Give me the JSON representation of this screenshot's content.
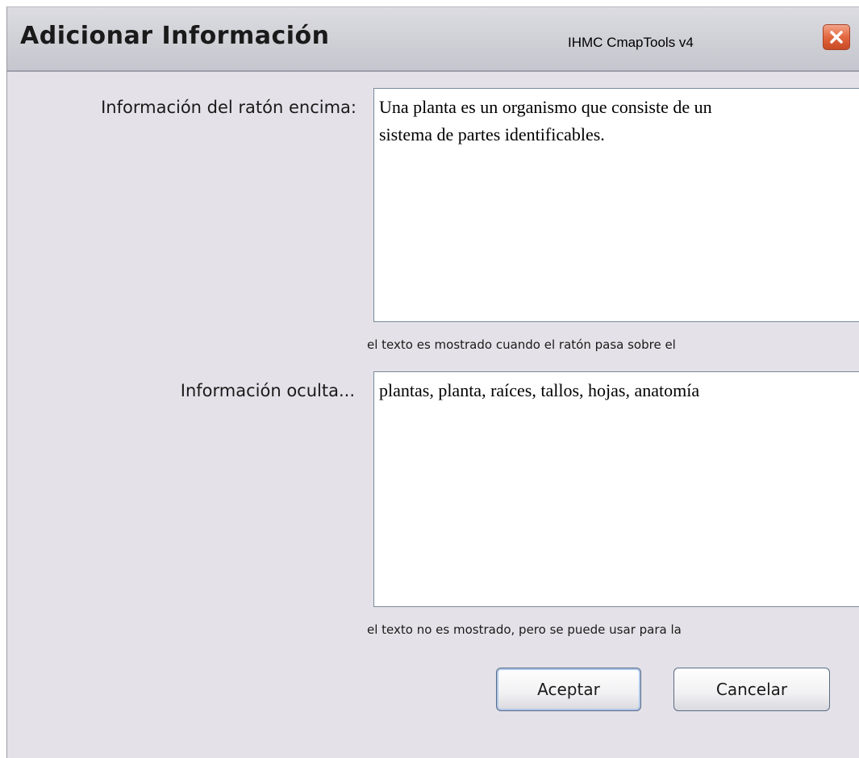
{
  "window": {
    "title": "Adicionar Información",
    "app_name": "IHMC CmapTools v4"
  },
  "form": {
    "mouseover": {
      "label": "Información del ratón encima:",
      "value": "Una planta es un organismo que consiste de un\nsistema de partes identificables.",
      "hint": "el texto es mostrado cuando el ratón pasa sobre el"
    },
    "hidden": {
      "label": "Información oculta...",
      "value": "plantas, planta, raíces, tallos, hojas, anatomía",
      "hint": "el texto no es mostrado, pero se puede usar para la"
    }
  },
  "buttons": {
    "accept": "Aceptar",
    "cancel": "Cancelar"
  },
  "icons": {
    "close": "close-icon"
  },
  "colors": {
    "dialog_bg": "#e4e2e8",
    "close_button": "#e2673f",
    "default_button_focus": "#aec6ea"
  }
}
